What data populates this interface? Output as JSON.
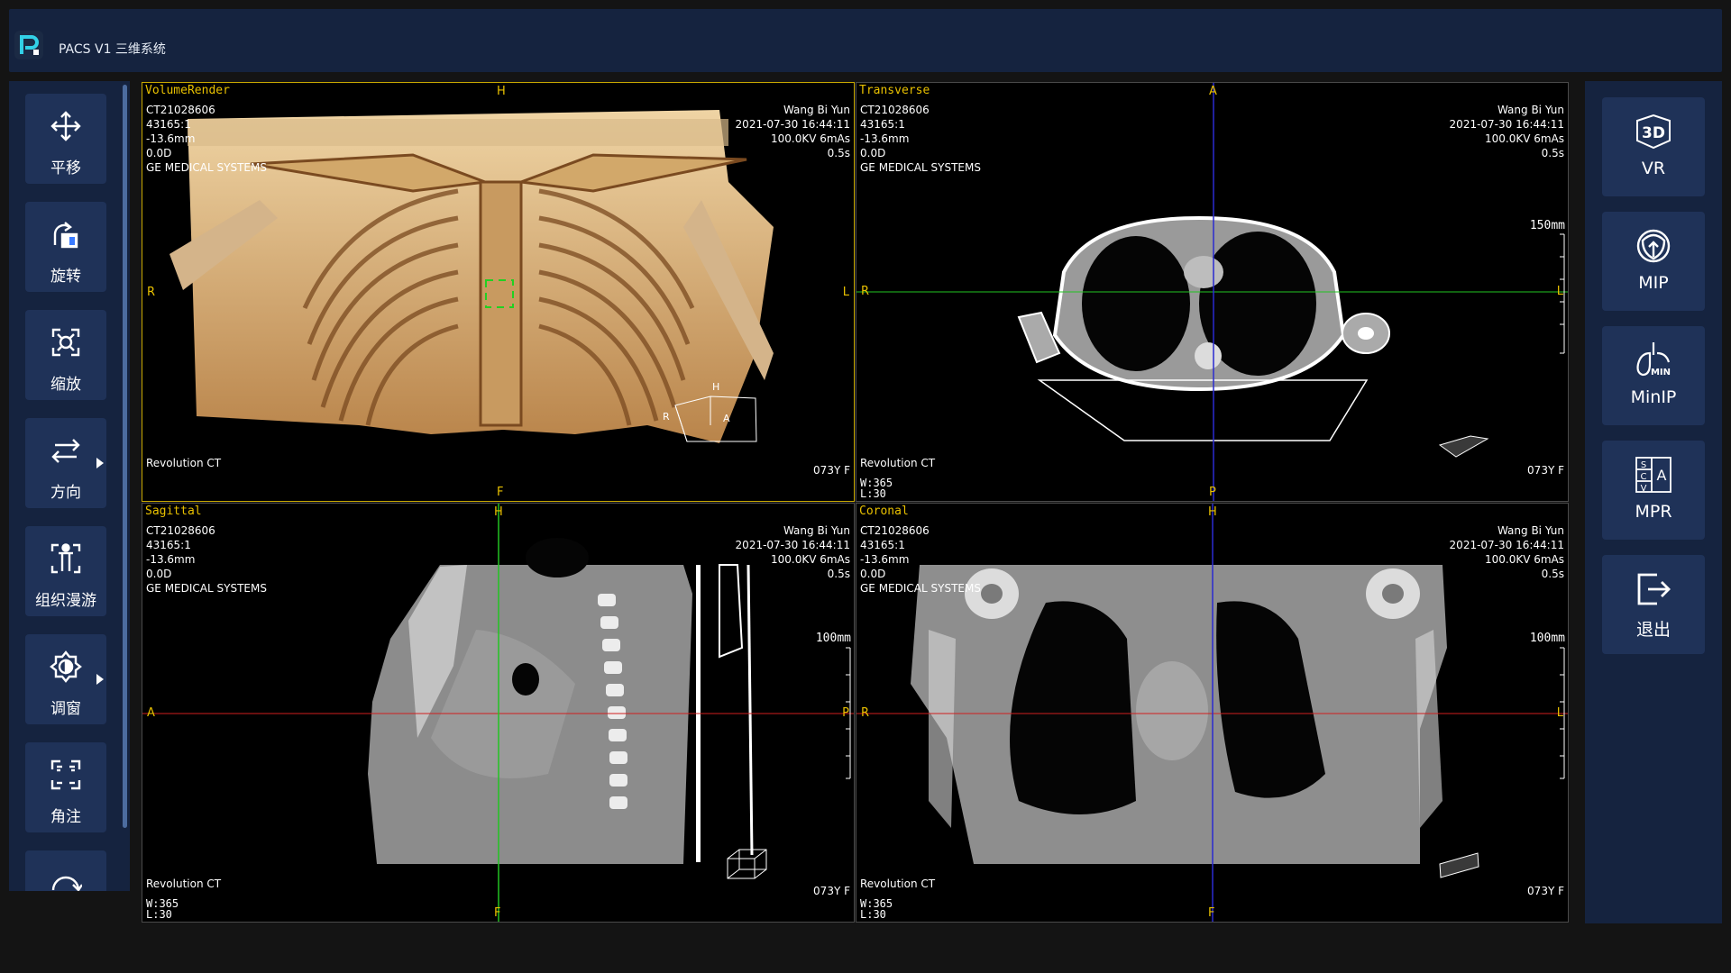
{
  "app": {
    "title": "PACS V1 三维系统"
  },
  "tools": [
    {
      "label": "平移",
      "icon": "move-icon"
    },
    {
      "label": "旋转",
      "icon": "rotate-icon"
    },
    {
      "label": "缩放",
      "icon": "zoom-icon"
    },
    {
      "label": "方向",
      "icon": "direction-icon"
    },
    {
      "label": "组织漫游",
      "icon": "tissue-roam-icon"
    },
    {
      "label": "调窗",
      "icon": "window-level-icon"
    },
    {
      "label": "角注",
      "icon": "corner-annotation-icon"
    },
    {
      "label": "",
      "icon": "reset-icon"
    }
  ],
  "modes": [
    {
      "label": "VR",
      "icon": "3d-icon"
    },
    {
      "label": "MIP",
      "icon": "mip-icon"
    },
    {
      "label": "MinIP",
      "icon": "minip-icon"
    },
    {
      "label": "MPR",
      "icon": "mpr-icon"
    },
    {
      "label": "退出",
      "icon": "exit-icon"
    }
  ],
  "viewports": {
    "vr": {
      "name": "VolumeRender",
      "info_left": "CT21028606\n43165:1\n-13.6mm\n0.0D\nGE MEDICAL SYSTEMS",
      "info_right": "Wang Bi Yun\n2021-07-30 16:44:11\n100.0KV 6mAs\n0.5s",
      "bottom_left": "Revolution CT",
      "bottom_right": "073Y F",
      "top": "H",
      "bottom": "F",
      "left": "R",
      "right": "L",
      "cube_r": "R",
      "cube_a": "A",
      "cube_h": "H"
    },
    "transverse": {
      "name": "Transverse",
      "info_left": "CT21028606\n43165:1\n-13.6mm\n0.0D\nGE MEDICAL SYSTEMS",
      "info_right": "Wang Bi Yun\n2021-07-30 16:44:11\n100.0KV 6mAs\n0.5s",
      "bottom_left": "Revolution CT",
      "bottom_right": "073Y F",
      "wl": "W:365\nL:30",
      "top": "A",
      "bottom": "P",
      "left": "R",
      "right": "L",
      "scale": "150mm"
    },
    "sagittal": {
      "name": "Sagittal",
      "info_left": "CT21028606\n43165:1\n-13.6mm\n0.0D\nGE MEDICAL SYSTEMS",
      "info_right": "Wang Bi Yun\n2021-07-30 16:44:11\n100.0KV 6mAs\n0.5s",
      "bottom_left": "Revolution CT",
      "bottom_right": "073Y F",
      "wl": "W:365\nL:30",
      "top": "H",
      "bottom": "F",
      "left": "A",
      "right": "P",
      "scale": "100mm"
    },
    "coronal": {
      "name": "Coronal",
      "info_left": "CT21028606\n43165:1\n-13.6mm\n0.0D\nGE MEDICAL SYSTEMS",
      "info_right": "Wang Bi Yun\n2021-07-30 16:44:11\n100.0KV 6mAs\n0.5s",
      "bottom_left": "Revolution CT",
      "bottom_right": "073Y F",
      "wl": "W:365\nL:30",
      "top": "H",
      "bottom": "F",
      "left": "R",
      "right": "L",
      "scale": "100mm"
    }
  },
  "colors": {
    "panel": "#15233f",
    "button": "#1f3258",
    "accent_yellow": "#e8c000",
    "crosshair_green": "#22c322",
    "crosshair_red": "#d01e1e",
    "crosshair_blue": "#2a2ad0"
  }
}
